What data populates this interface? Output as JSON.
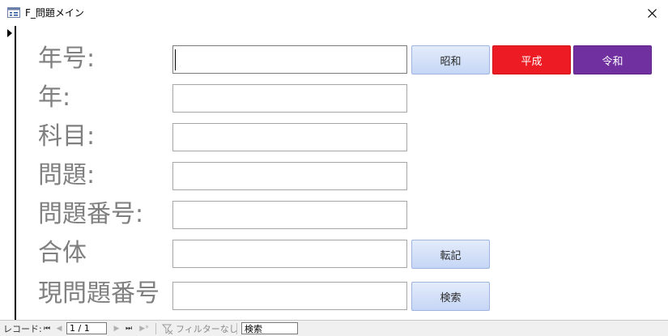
{
  "window": {
    "title": "F_問題メイン",
    "icon": "form-icon",
    "close_symbol": "✕"
  },
  "form": {
    "fields": [
      {
        "label": "年号:",
        "value": ""
      },
      {
        "label": "年:",
        "value": ""
      },
      {
        "label": "科目:",
        "value": ""
      },
      {
        "label": "問題:",
        "value": ""
      },
      {
        "label": "問題番号:",
        "value": ""
      },
      {
        "label": "合体",
        "value": ""
      },
      {
        "label": "現問題番号",
        "value": ""
      }
    ],
    "buttons": {
      "showa": "昭和",
      "heisei": "平成",
      "reiwa": "令和",
      "transcribe": "転記",
      "search": "検索"
    }
  },
  "navigation": {
    "record_label": "レコード:",
    "first": "⏮",
    "previous": "◀",
    "position": "1 / 1",
    "next": "▶",
    "last": "⏭",
    "new": "▶*",
    "filter_status": "フィルターなし",
    "search_value": "検索"
  },
  "colors": {
    "label_gray": "#7f7f7f",
    "heisei_red": "#ed1c24",
    "reiwa_purple": "#7030a0",
    "button_blue": "#c5d6f5"
  }
}
